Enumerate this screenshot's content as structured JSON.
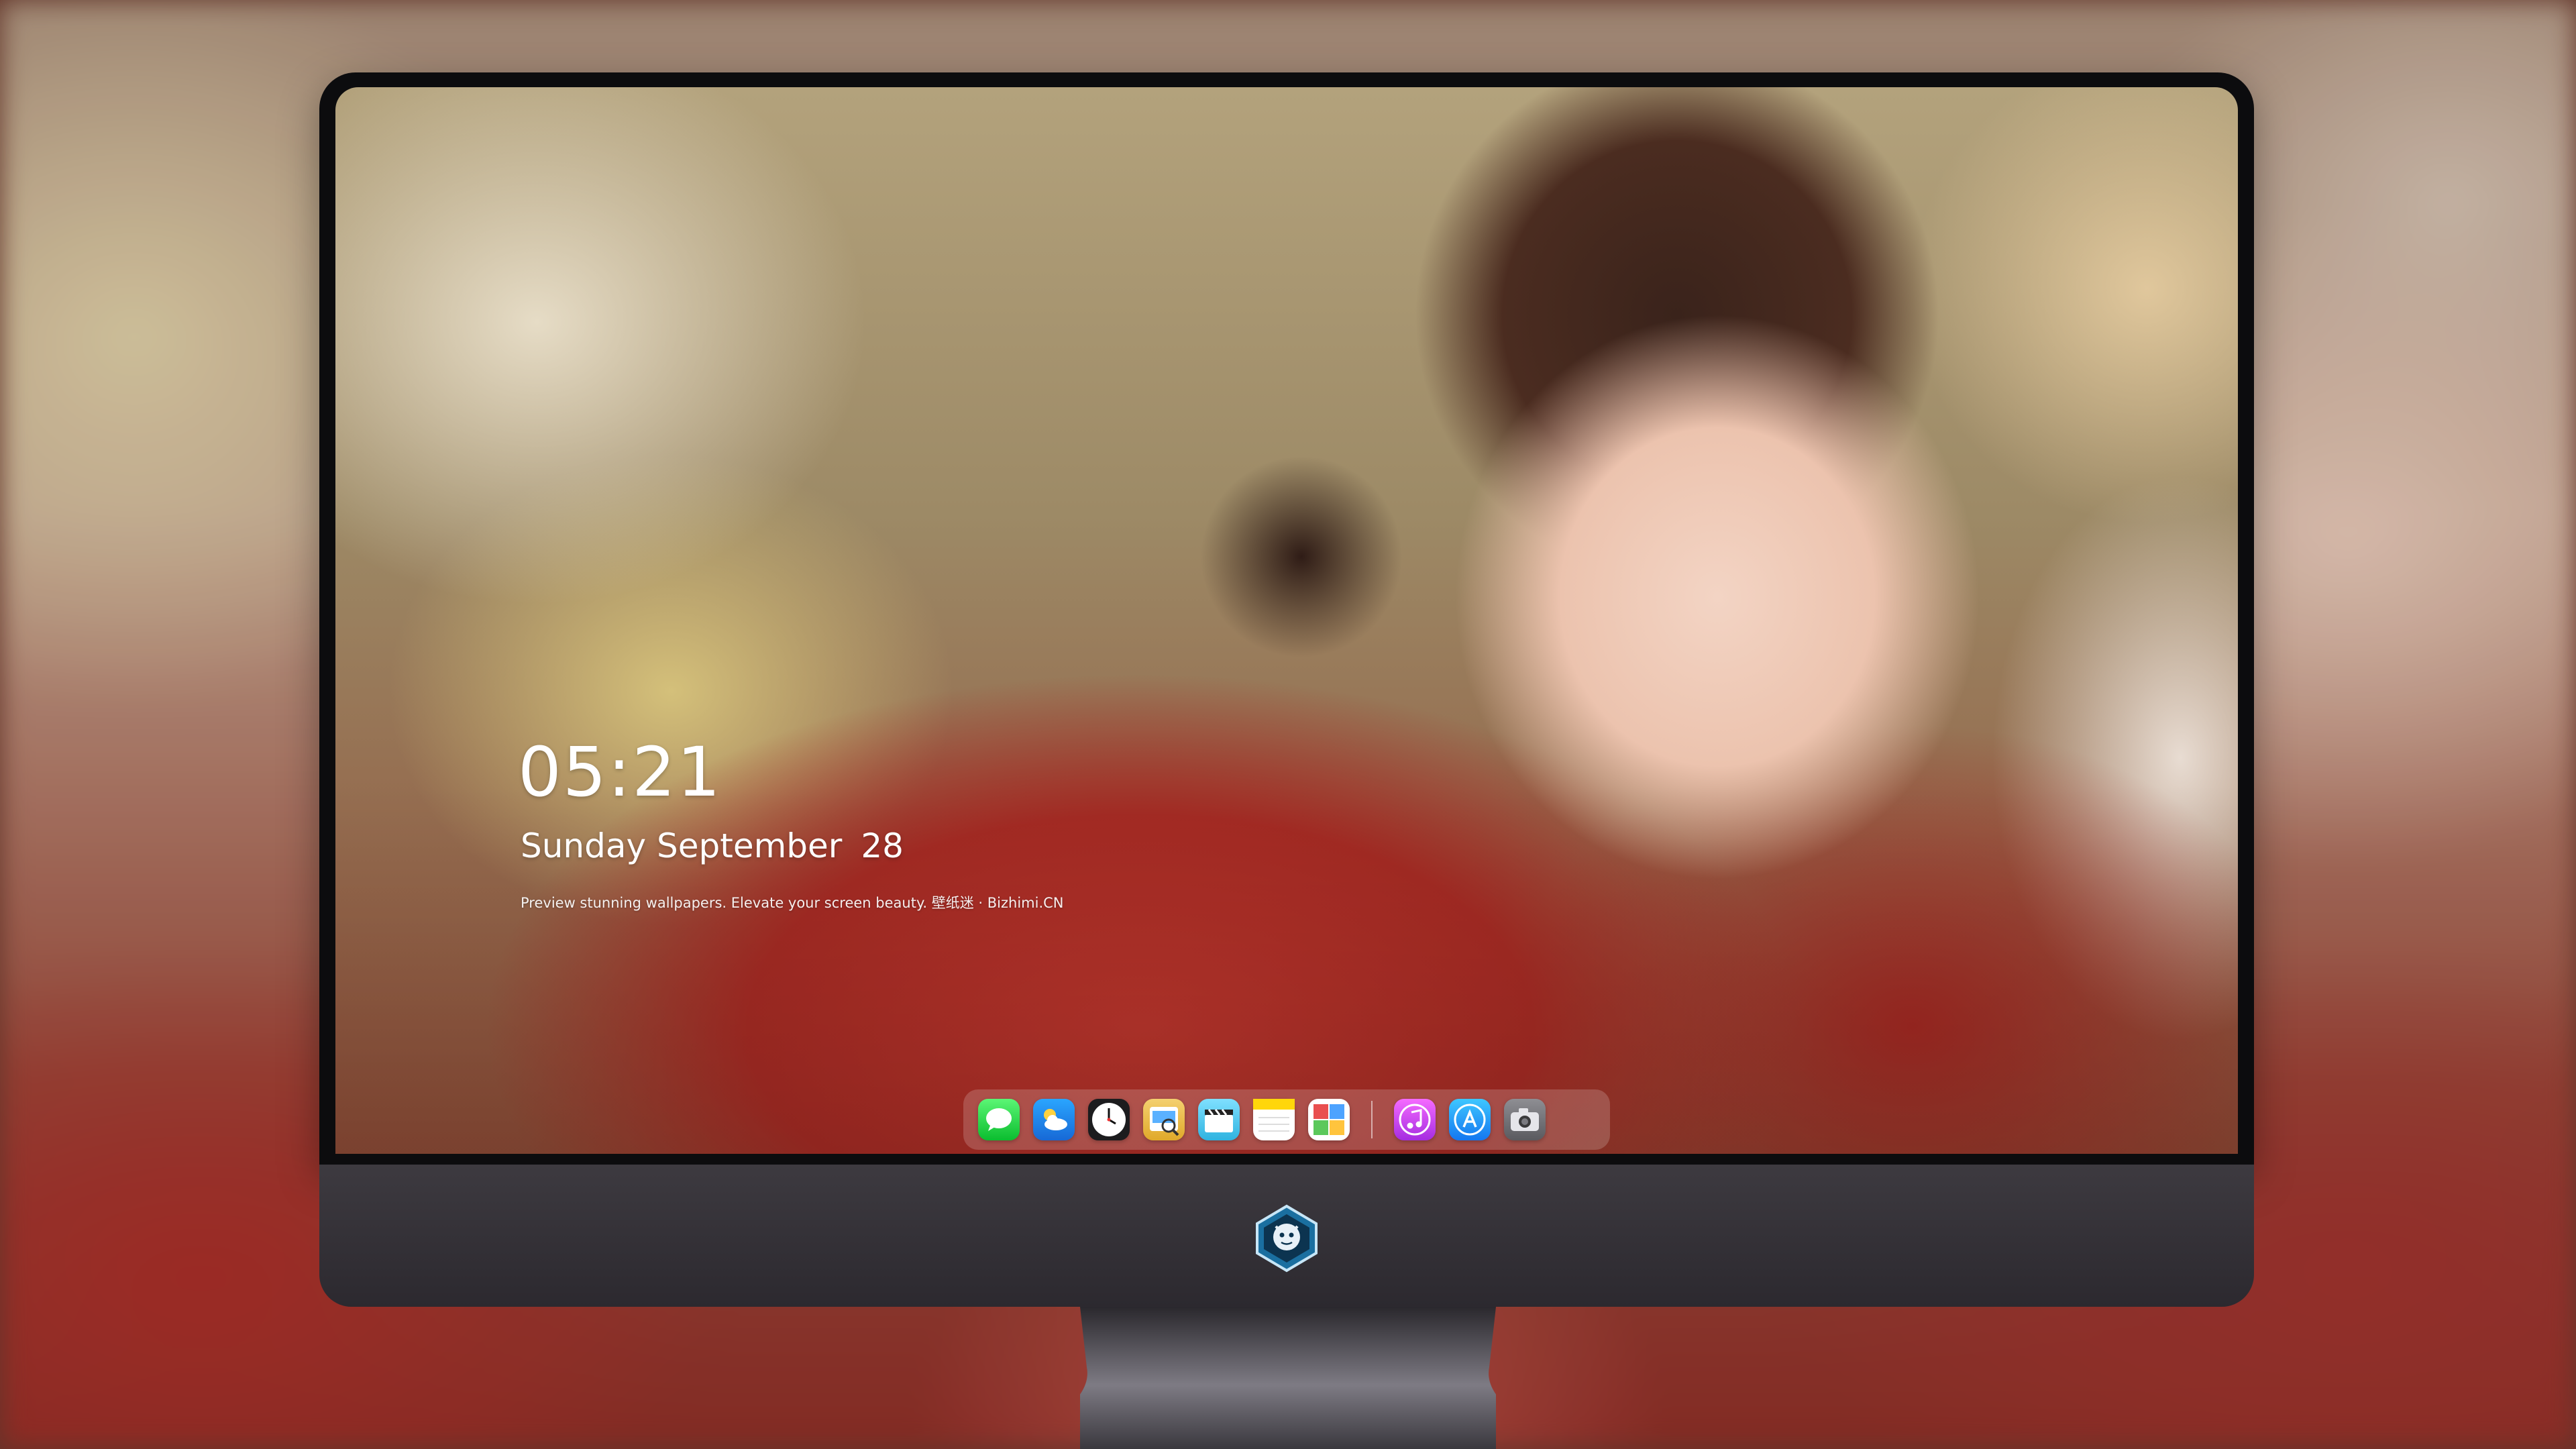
{
  "lockscreen": {
    "time": "05:21",
    "weekday_month": "Sunday September",
    "day": "28",
    "caption": "Preview stunning wallpapers. Elevate your screen beauty. 壁纸迷 · Bizhimi.CN"
  },
  "dock": {
    "apps": [
      {
        "name": "messages-icon",
        "color": "#34c759"
      },
      {
        "name": "weather-icon",
        "color": "#1e90ff"
      },
      {
        "name": "clock-icon",
        "color": "#1c1c1e"
      },
      {
        "name": "preview-icon",
        "color": "#f2c14e"
      },
      {
        "name": "clips-icon",
        "color": "#5ac8fa"
      },
      {
        "name": "notes-icon",
        "color": "#ffd60a"
      },
      {
        "name": "photo-booth-icon",
        "color": "#4caf50"
      },
      {
        "name": "itunes-icon",
        "color": "#d63af9"
      },
      {
        "name": "app-store-icon",
        "color": "#1a8cff"
      },
      {
        "name": "camera-icon",
        "color": "#6e6e73"
      }
    ]
  },
  "monitor": {
    "logo": "bizhimi-logo"
  }
}
